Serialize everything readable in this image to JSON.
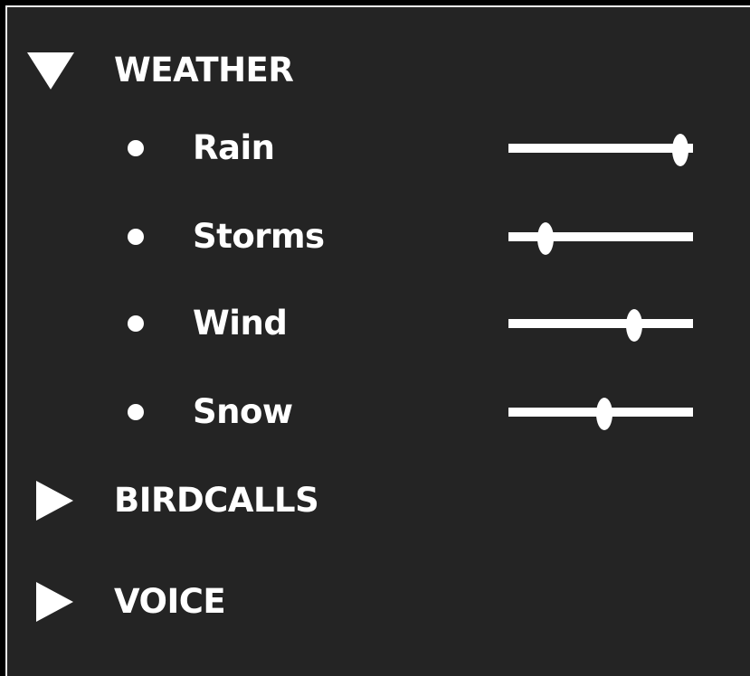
{
  "sections": [
    {
      "title": "WEATHER",
      "expanded": true,
      "icon": "triangle-down-icon",
      "items": [
        {
          "label": "Rain",
          "value": 0.93
        },
        {
          "label": "Storms",
          "value": 0.2
        },
        {
          "label": "Wind",
          "value": 0.68
        },
        {
          "label": "Snow",
          "value": 0.52
        }
      ]
    },
    {
      "title": "BIRDCALLS",
      "expanded": false,
      "icon": "triangle-right-icon"
    },
    {
      "title": "VOICE",
      "expanded": false,
      "icon": "triangle-right-icon"
    }
  ],
  "colors": {
    "background": "#242424",
    "foreground": "#ffffff"
  }
}
